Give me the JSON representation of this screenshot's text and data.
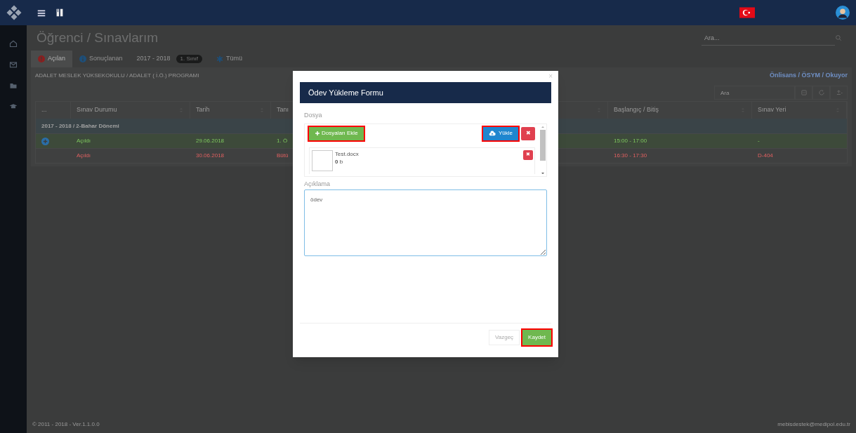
{
  "page_title": "Öğrenci / Sınavlarım",
  "search": {
    "placeholder": "Ara..."
  },
  "tabs": [
    {
      "label": "Açılan",
      "kind": "alert",
      "selected": true
    },
    {
      "label": "Sonuçlanan",
      "kind": "info",
      "selected": false
    },
    {
      "label": "2017 - 2018",
      "kind": "badge",
      "badge": "1. Sınıf",
      "selected": false
    },
    {
      "label": "Tümü",
      "kind": "asterisk",
      "selected": false
    }
  ],
  "program": "ADALET MESLEK YÜKSEKOKULU / ADALET ( İ.Ö.) PROGRAMI",
  "status": "Önlisans / ÖSYM / Okuyor",
  "table_search": {
    "placeholder": "Ara"
  },
  "table": {
    "columns": [
      "...",
      "Sınav Durumu",
      "Tarih",
      "Tanı",
      "Başlangıç / Bitiş",
      "Sınav Yeri"
    ],
    "group": "2017 - 2018 / 2-Bahar Dönemi",
    "rows": [
      {
        "kind": "success",
        "expandable": true,
        "cells": [
          "",
          "Açıldı",
          "29.06.2018",
          "1. Ö",
          "15:00 - 17:00",
          "-"
        ]
      },
      {
        "kind": "danger",
        "expandable": false,
        "cells": [
          "",
          "Açıldı",
          "30.06.2018",
          "Bütü",
          "16:30 - 17:30",
          "D-404"
        ]
      }
    ]
  },
  "modal": {
    "title": "Ödev Yükleme Formu",
    "close": "×",
    "file_label": "Dosya",
    "add_button": {
      "label": "Dosyaları Ekle",
      "highlighted": true
    },
    "upload_button": {
      "label": "Yükle",
      "highlighted": true
    },
    "remove_button": "✖",
    "files": [
      {
        "name": "Test.docx",
        "size": "**0** b",
        "remove": "✖"
      }
    ],
    "description_label": "Açıklama",
    "description": "ödev",
    "cancel_button": {
      "label": "Vazgeç",
      "highlighted": false
    },
    "save_button": {
      "label": "Kaydet",
      "highlighted": true
    }
  },
  "footer": {
    "version": "© 2011 - 2018 - Ver.1.1.0.0",
    "email": "mebisdestek@medipol.edu.tr"
  }
}
